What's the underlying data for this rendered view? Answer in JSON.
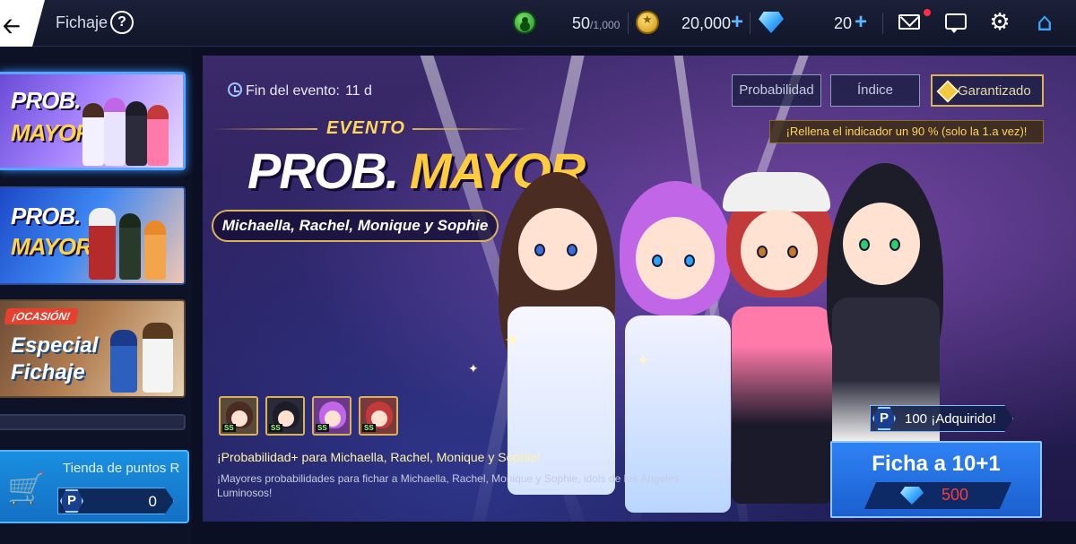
{
  "header": {
    "title": "Fichaje",
    "energy": {
      "value": "50",
      "max": "/1,000"
    },
    "coins": "20,000",
    "gems": "20",
    "icons": [
      "back-arrow-icon",
      "help-icon",
      "energy-icon",
      "coin-icon",
      "gem-icon",
      "mail-icon",
      "chat-icon",
      "gear-icon",
      "home-icon"
    ],
    "plus": "+"
  },
  "sidebar": {
    "banners": [
      {
        "line1": "PROB.",
        "line2": "MAYOR",
        "selected": true
      },
      {
        "line1": "PROB.",
        "line2": "MAYOR",
        "selected": false
      },
      {
        "tag": "¡OCASIÓN!",
        "line1": "Especial",
        "line2": "Fichaje",
        "selected": false
      }
    ],
    "shop": {
      "label": "Tienda de puntos R",
      "badge": "P",
      "points": "0"
    }
  },
  "event": {
    "end_label": "Fin del evento:",
    "end_value": "11 d",
    "kicker": "EVENTO",
    "title_a": "PROB.",
    "title_b": "MAYOR",
    "names": "Michaella, Rachel, Monique y Sophie",
    "buttons": {
      "probability": "Probabilidad",
      "index": "Índice",
      "guaranteed": "Garantizado"
    },
    "refill_note": "¡Rellena el indicador un 90 % (solo la 1.a vez)!",
    "portraits": [
      {
        "tag": "SS",
        "hair": "#4a2c22"
      },
      {
        "tag": "SS",
        "hair": "#1d1d2a"
      },
      {
        "tag": "SS",
        "hair": "#c066e6"
      },
      {
        "tag": "SS",
        "hair": "#c23a3a"
      }
    ],
    "desc_title": "¡Probabilidad+ para Michaella, Rachel, Monique y Sophie!",
    "desc_text": "¡Mayores probabilidades para fichar a Michaella, Rachel, Monique y Sophie, idols de los Ángeles Luminosos!",
    "acquired": {
      "badge": "P",
      "text": "100 ¡Adquirido!"
    },
    "pull": {
      "label": "Ficha a 10+1",
      "cost": "500"
    }
  },
  "colors": {
    "accent_blue": "#2f82f4",
    "gold": "#ffcc3d",
    "cost_red": "#ff3a3a"
  }
}
